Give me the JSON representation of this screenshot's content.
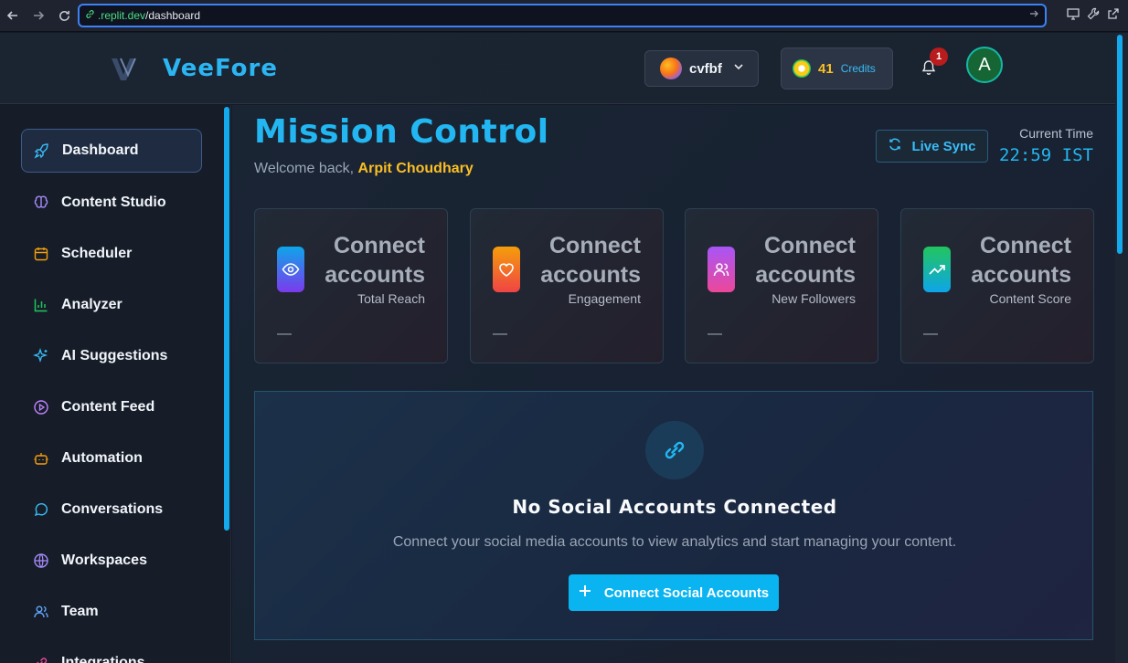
{
  "browser": {
    "url_host": ".replit.dev",
    "url_path": "/dashboard"
  },
  "header": {
    "brand": "VeeFore",
    "workspace": "cvfbf",
    "credits_value": "41",
    "credits_label": "Credits",
    "notification_count": "1",
    "avatar_initial": "A"
  },
  "sidebar": {
    "items": [
      {
        "label": "Dashboard",
        "icon": "rocket-icon",
        "active": true
      },
      {
        "label": "Content Studio",
        "icon": "brain-icon"
      },
      {
        "label": "Scheduler",
        "icon": "calendar-icon"
      },
      {
        "label": "Analyzer",
        "icon": "bar-chart-icon"
      },
      {
        "label": "AI Suggestions",
        "icon": "sparkles-icon"
      },
      {
        "label": "Content Feed",
        "icon": "play-circle-icon"
      },
      {
        "label": "Automation",
        "icon": "bot-icon"
      },
      {
        "label": "Conversations",
        "icon": "chat-icon"
      },
      {
        "label": "Workspaces",
        "icon": "globe-icon"
      },
      {
        "label": "Team",
        "icon": "users-icon"
      },
      {
        "label": "Integrations",
        "icon": "link-icon"
      }
    ]
  },
  "main": {
    "title": "Mission Control",
    "welcome_prefix": "Welcome back, ",
    "user_name": "Arpit Choudhary",
    "live_sync": "Live Sync",
    "time_label": "Current Time",
    "time_value": "22:59 IST",
    "cards": [
      {
        "value": "Connect accounts",
        "label": "Total Reach",
        "trend": "—",
        "icon": "eye-icon",
        "color_from": "#0ea5e9",
        "color_to": "#7c3aed"
      },
      {
        "value": "Connect accounts",
        "label": "Engagement",
        "trend": "—",
        "icon": "heart-icon",
        "color_from": "#f97316",
        "color_to": "#ef4444"
      },
      {
        "value": "Connect accounts",
        "label": "New Followers",
        "trend": "—",
        "icon": "users-icon",
        "color_from": "#a855f7",
        "color_to": "#ec4899"
      },
      {
        "value": "Connect accounts",
        "label": "Content Score",
        "trend": "—",
        "icon": "trending-up-icon",
        "color_from": "#22c55e",
        "color_to": "#0ea5e9"
      }
    ],
    "empty": {
      "title": "No Social Accounts Connected",
      "text": "Connect your social media accounts to view analytics and start managing your content.",
      "button": "Connect Social Accounts"
    }
  },
  "colors": {
    "accent": "#22b7f2",
    "highlight": "#fbbf24",
    "button": "#0ab4f0"
  }
}
